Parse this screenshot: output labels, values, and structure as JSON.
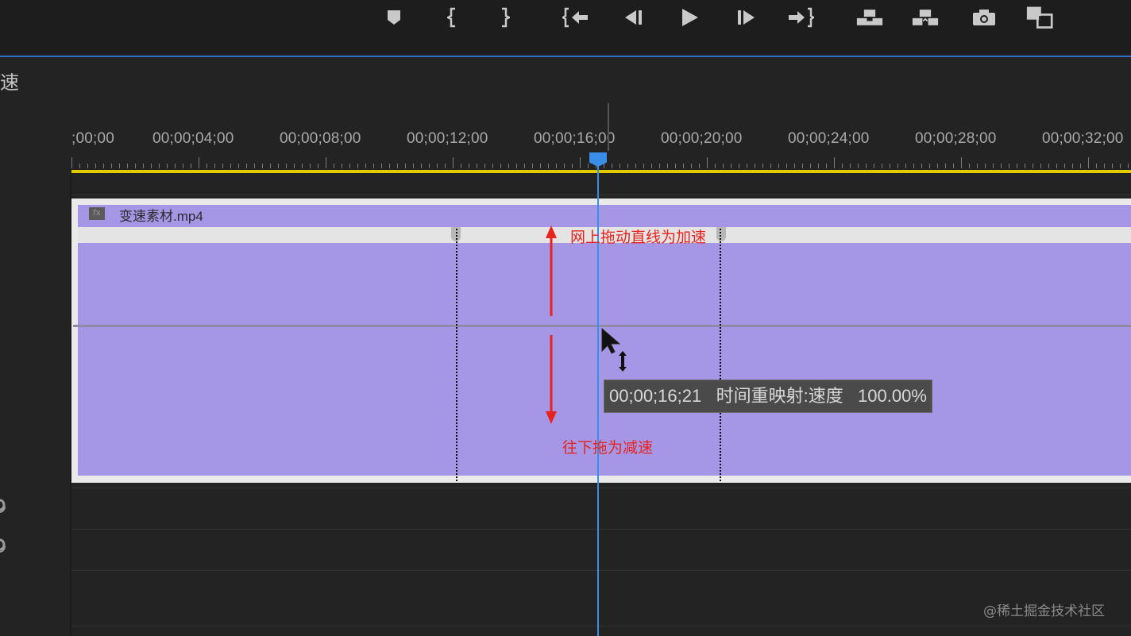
{
  "toolbar": {
    "buttons": [
      {
        "name": "add-marker-icon"
      },
      {
        "name": "mark-in-icon"
      },
      {
        "name": "mark-out-icon"
      },
      {
        "name": "go-to-in-icon"
      },
      {
        "name": "step-back-icon"
      },
      {
        "name": "play-icon"
      },
      {
        "name": "step-forward-icon"
      },
      {
        "name": "go-to-out-icon"
      },
      {
        "name": "lift-icon"
      },
      {
        "name": "extract-icon"
      },
      {
        "name": "export-frame-icon"
      },
      {
        "name": "comparison-view-icon"
      }
    ]
  },
  "panel": {
    "title_fragment": "速"
  },
  "ruler": {
    "timecodes": [
      ";00;00",
      "00;00;04;00",
      "00;00;08;00",
      "00;00;12;00",
      "00;00;16;00",
      "00;00;20;00",
      "00;00;24;00",
      "00;00;28;00",
      "00;00;32;00"
    ]
  },
  "clip": {
    "name": "变速素材.mp4",
    "fx_badge": "fx"
  },
  "annotations": {
    "up": "网上拖动直线为加速",
    "down": "往下拖为减速"
  },
  "tooltip": {
    "timecode": "00;00;16;21",
    "property": "时间重映射:速度",
    "value": "100.00%"
  },
  "watermark": "@稀土掘金技术社区",
  "colors": {
    "clip": "#a697e6",
    "playhead": "#3b8ee8",
    "work_area": "#e3c900",
    "annotation": "#e8221d"
  }
}
